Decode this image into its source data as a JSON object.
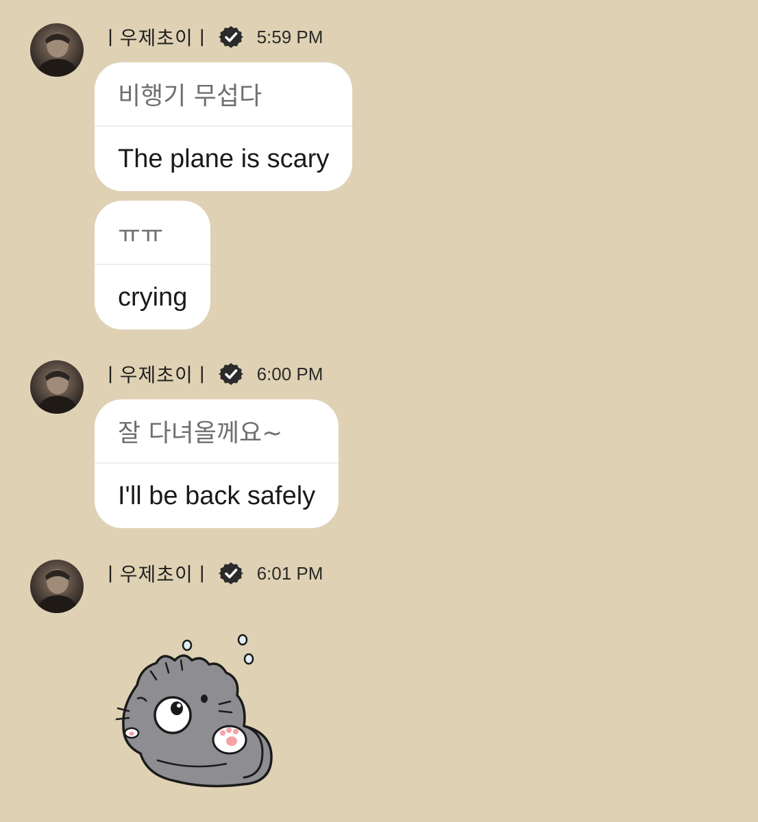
{
  "messages": [
    {
      "sender": "ㅣ우제초이ㅣ",
      "time": "5:59 PM",
      "bubbles": [
        {
          "original": "비행기 무섭다",
          "translation": "The plane is scary"
        },
        {
          "original": "ㅠㅠ",
          "translation": "crying"
        }
      ]
    },
    {
      "sender": "ㅣ우제초이ㅣ",
      "time": "6:00 PM",
      "bubbles": [
        {
          "original": "잘 다녀올께요~",
          "translation": "I'll be back safely"
        }
      ]
    },
    {
      "sender": "ㅣ우제초이ㅣ",
      "time": "6:01 PM",
      "sticker": "crying-gray-cat-sticker"
    }
  ],
  "icons": {
    "verified": "verified-badge-icon"
  },
  "colors": {
    "background": "#dfd1b3",
    "bubble": "#ffffff",
    "original_text": "#6f6f6f",
    "translation_text": "#1a1a1a"
  }
}
